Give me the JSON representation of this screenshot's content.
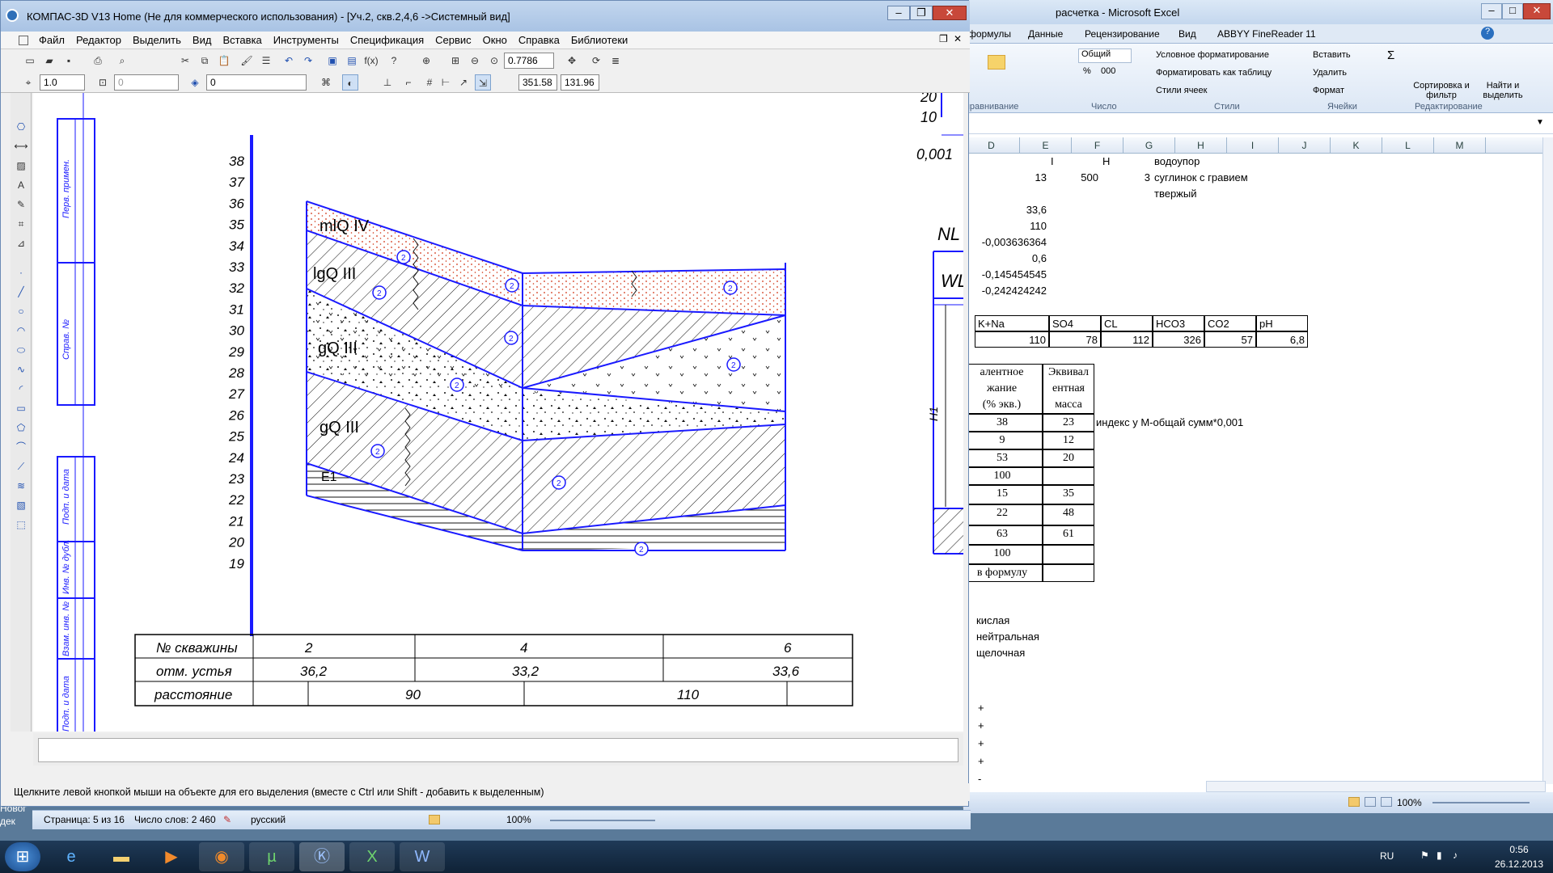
{
  "word": {
    "page": "Страница: 5 из 16",
    "words": "Число слов: 2 460",
    "lang": "русский",
    "zoom": "100%",
    "bg_text_1": "Новог",
    "bg_text_2": "дек"
  },
  "excel": {
    "title": "расчетка - Microsoft Excel",
    "tabs": [
      "формулы",
      "Данные",
      "Рецензирование",
      "Вид",
      "ABBYY FineReader 11"
    ],
    "ribbon": {
      "number_format": "Общий",
      "cond_format": "Условное форматирование",
      "format_table": "Форматировать как таблицу",
      "cell_styles": "Стили ячеек",
      "insert": "Вставить",
      "delete": "Удалить",
      "format": "Формат",
      "sort": "Сортировка и фильтр",
      "find": "Найти и выделить",
      "group_align": "ыравнивание",
      "group_number": "Число",
      "group_styles": "Стили",
      "group_cells": "Ячейки",
      "group_edit": "Редактирование",
      "percent": "%",
      "thousands": "000",
      "sigma": "Σ"
    },
    "columns": [
      "D",
      "E",
      "F",
      "G",
      "H",
      "I",
      "J",
      "K",
      "L",
      "M"
    ],
    "cells": {
      "e1": "I",
      "f1": "H",
      "g1": "водоупор",
      "d2": "13",
      "e2": "500",
      "f2": "3",
      "g2": "суглинок с гравием",
      "g3": "твержый",
      "d4": "33,6",
      "d5": "110",
      "d6": "-0,003636364",
      "d7": "0,6",
      "d8": "-0,145454545",
      "d9": "-0,242424242",
      "ion_headers": [
        "K+Na",
        "SO4",
        "CL",
        "HCO3",
        "CO2",
        "pH"
      ],
      "ion_values": [
        "110",
        "78",
        "112",
        "326",
        "57",
        "6,8"
      ],
      "hdr1a": "алентное",
      "hdr1b": "жание",
      "hdr1c": "(% экв.)",
      "hdr2a": "Эквивал",
      "hdr2b": "ентная",
      "hdr2c": "масса",
      "col1": [
        "38",
        "9",
        "53",
        "100",
        "15",
        "22",
        "63",
        "100"
      ],
      "col2": [
        "23",
        "12",
        "20",
        "",
        "35",
        "48",
        "61",
        ""
      ],
      "note": "индекс у М-общай сумм*0,001",
      "formula_cell": "в формулу",
      "acid": [
        "кислая",
        "нейтральная",
        "щелочная"
      ],
      "plus": [
        "+",
        "+",
        "+",
        "+",
        "-"
      ]
    },
    "status_zoom": "100%"
  },
  "kompas": {
    "title": "КОМПАС-3D V13 Home (Не для коммерческого использования) - [Уч.2, скв.2,4,6 ->Системный вид]",
    "menu": [
      "Файл",
      "Редактор",
      "Выделить",
      "Вид",
      "Вставка",
      "Инструменты",
      "Спецификация",
      "Сервис",
      "Окно",
      "Справка",
      "Библиотеки"
    ],
    "zoom": "0.7786",
    "line_scale": "1.0",
    "field2": "0",
    "layer": "0",
    "coord_x": "351.58",
    "coord_y": "131.96",
    "hint": "Щелкните левой кнопкой мыши на объекте для его выделения (вместе с Ctrl или Shift - добавить к выделенным)",
    "stamp": [
      "Перв. примен.",
      "Справ. №",
      "Подп. и дата",
      "Инв. № дубл.",
      "Взам. инв. №",
      "Подп. и дата"
    ],
    "scale": [
      "38",
      "37",
      "36",
      "35",
      "34",
      "33",
      "32",
      "31",
      "30",
      "29",
      "28",
      "27",
      "26",
      "25",
      "24",
      "23",
      "22",
      "21",
      "20",
      "19"
    ],
    "layers": [
      "mlQ IV",
      "lgQ III",
      "gQ III",
      "gQ III",
      "E1"
    ],
    "right_top": [
      "20",
      "10",
      "0,001"
    ],
    "right_labels": [
      "NL",
      "WL",
      "H1"
    ],
    "table": {
      "row_labels": [
        "№ скважины",
        "отм. устья",
        "расстояние"
      ],
      "wells": [
        "2",
        "4",
        "6"
      ],
      "elevations": [
        "36,2",
        "33,2",
        "33,6"
      ],
      "distances": [
        "90",
        "110"
      ]
    },
    "markers": [
      "2",
      "2",
      "2",
      "2",
      "2",
      "2",
      "2",
      "2",
      "2",
      "2"
    ]
  },
  "taskbar": {
    "lang": "RU",
    "time": "0:56",
    "date": "26.12.2013",
    "apps": [
      "start",
      "ie",
      "explorer",
      "media",
      "firefox",
      "utorrent",
      "kompas",
      "excel",
      "word"
    ]
  },
  "colors": {
    "drawing_blue": "#1a1aff",
    "sand_red": "#d03010",
    "title_bar": "#b8cfe9"
  }
}
